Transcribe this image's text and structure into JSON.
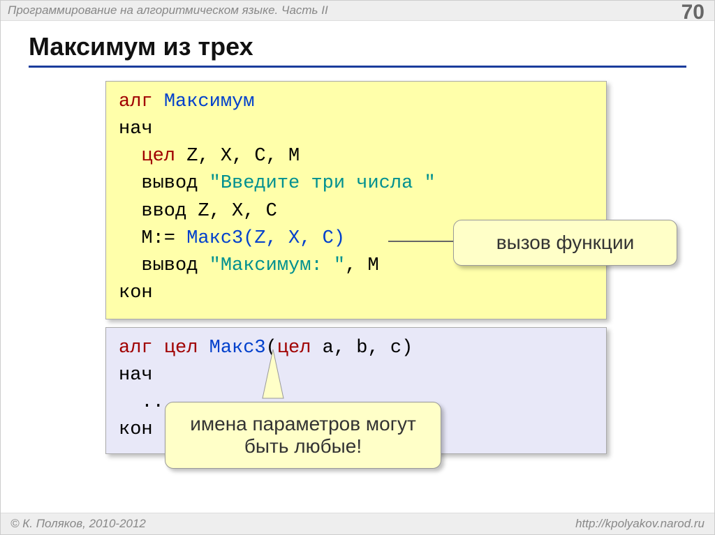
{
  "header": {
    "title": "Программирование на алгоритмическом языке. Часть II",
    "page_number": "70"
  },
  "slide_title": "Максимум из трех",
  "code1": {
    "l1a": "алг",
    "l1b": "Максимум",
    "l2": "нач",
    "l3a": "цел",
    "l3b": " Z, X, C, M",
    "l4a": "  вывод ",
    "l4b": "\"Введите три числа \"",
    "l5": "  ввод Z, X, C",
    "l6a": "  M:= ",
    "l6b": "Макс3(Z, X, C)",
    "l7a": "  вывод ",
    "l7b": "\"Максимум: \"",
    "l7c": ", M",
    "l8": "кон"
  },
  "code2": {
    "l1a": "алг",
    "l1b": "цел",
    "l1c": "Макс3",
    "l1d": "(",
    "l1e": "цел",
    "l1f": " a, b, c)",
    "l2": "нач",
    "l3": "  ...",
    "l4": "кон"
  },
  "callout1": "вызов функции",
  "callout2": "имена параметров могут быть любые!",
  "footer": {
    "left": "© К. Поляков, 2010-2012",
    "right": "http://kpolyakov.narod.ru"
  }
}
